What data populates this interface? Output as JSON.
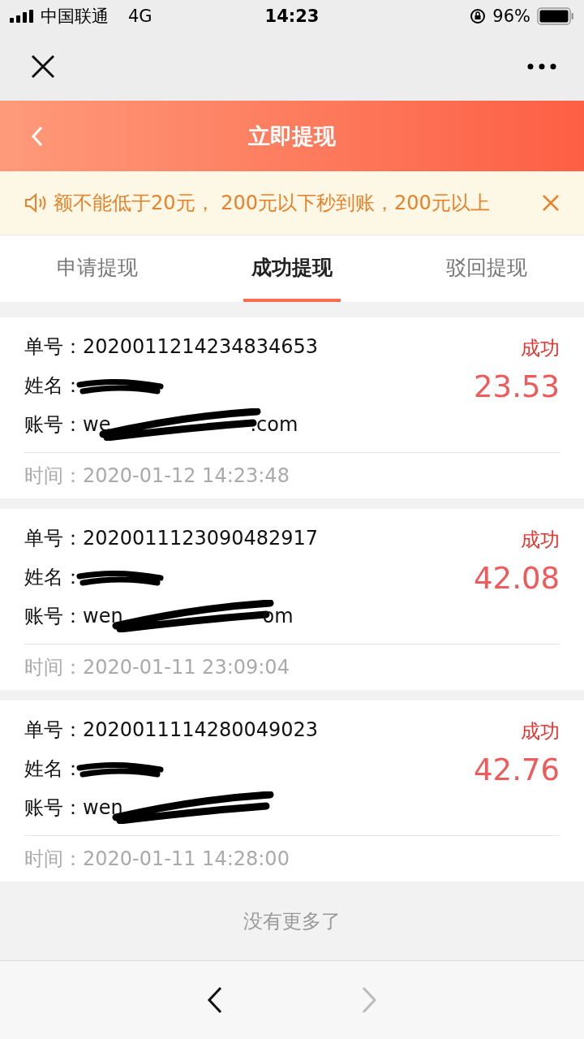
{
  "status_bar": {
    "carrier": "中国联通",
    "network": "4G",
    "time": "14:23",
    "battery": "96%"
  },
  "nav": {
    "title": "立即提现"
  },
  "notice": {
    "text": "额不能低于20元， 200元以下秒到账，200元以上"
  },
  "tabs": [
    {
      "label": "申请提现",
      "selected": false
    },
    {
      "label": "成功提现",
      "selected": true
    },
    {
      "label": "驳回提现",
      "selected": false
    }
  ],
  "records": [
    {
      "order_label": "单号：",
      "order": "2020011214234834653",
      "name_label": "姓名：",
      "account_label": "账号：",
      "account_start": "we",
      "account_end": ".com",
      "status": "成功",
      "amount": "23.53",
      "time_label": "时间：",
      "time": "2020-01-12 14:23:48"
    },
    {
      "order_label": "单号：",
      "order": "2020011123090482917",
      "name_label": "姓名：",
      "account_label": "账号：",
      "account_start": "wen",
      "account_end": "om",
      "status": "成功",
      "amount": "42.08",
      "time_label": "时间：",
      "time": "2020-01-11 23:09:04"
    },
    {
      "order_label": "单号：",
      "order": "2020011114280049023",
      "name_label": "姓名：",
      "account_label": "账号：",
      "account_start": "wen",
      "status": "成功",
      "amount": "42.76",
      "time_label": "时间：",
      "time": "2020-01-11 14:28:00"
    }
  ],
  "footer_note": "没有更多了"
}
